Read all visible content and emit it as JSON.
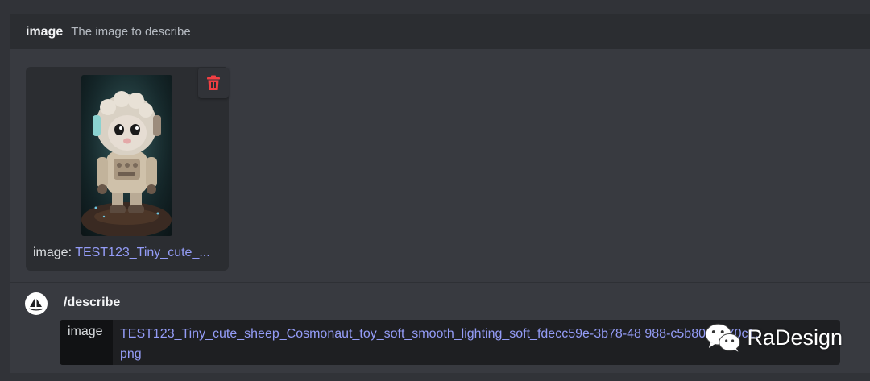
{
  "option": {
    "name": "image",
    "description": "The image to describe"
  },
  "attachment": {
    "caption_label": "image:",
    "caption_value": "TEST123_Tiny_cute_...",
    "delete_icon": "trash-icon"
  },
  "command": {
    "name": "/describe",
    "param_key": "image",
    "param_value": "TEST123_Tiny_cute_sheep_Cosmonaut_toy_soft_smooth_lighting_soft_fdecc59e-3b78-48  988-c5b80a0570c1.png"
  },
  "watermark": {
    "text": "RaDesign",
    "icon": "wechat-icon"
  },
  "colors": {
    "link": "#949cf7",
    "delete": "#f23f43",
    "background": "#313338"
  }
}
